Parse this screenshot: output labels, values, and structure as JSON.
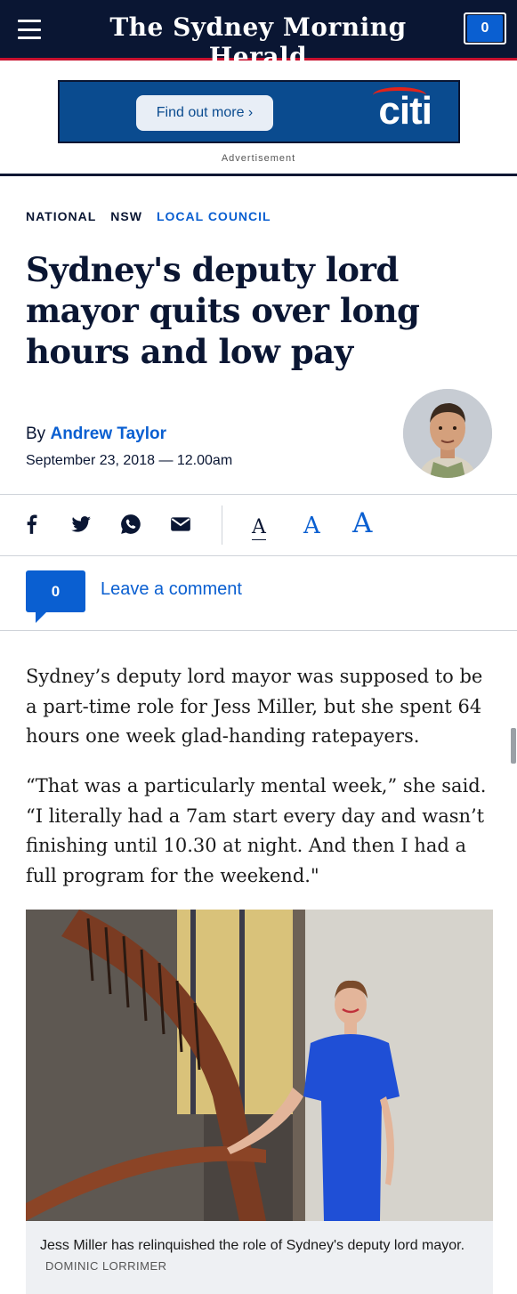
{
  "header": {
    "masthead": "The Sydney Morning Herald",
    "comment_count": "0"
  },
  "ad": {
    "button_label": "Find out more ›",
    "brand": "citi",
    "label": "Advertisement"
  },
  "breadcrumbs": [
    "NATIONAL",
    "NSW",
    "LOCAL COUNCIL"
  ],
  "article": {
    "headline": "Sydney's deputy lord mayor quits over long hours and low pay",
    "byline_prefix": "By",
    "author": "Andrew Taylor",
    "date": "September 23, 2018 — 12.00am",
    "paragraphs": [
      "Sydney’s deputy lord mayor was supposed to be a part-time role for Jess Miller, but she spent 64 hours one week glad-handing ratepayers.",
      "“That was a particularly mental week,” she said. “I literally had a 7am start every day and wasn’t finishing until 10.30 at night. And then I had a full program for the weekend.\""
    ],
    "photo_caption": "Jess Miller has relinquished the role of Sydney's deputy lord mayor.",
    "photo_credit": "DOMINIC LORRIMER"
  },
  "share": {
    "icons": [
      "facebook-icon",
      "twitter-icon",
      "whatsapp-icon",
      "email-icon"
    ],
    "font_sizes": [
      "A",
      "A",
      "A"
    ]
  },
  "comments": {
    "count": "0",
    "label": "Leave a comment"
  },
  "colors": {
    "navy": "#0a1633",
    "accent_blue": "#0a5fd1",
    "ad_blue": "#0a4b8f",
    "red": "#c8102e"
  }
}
